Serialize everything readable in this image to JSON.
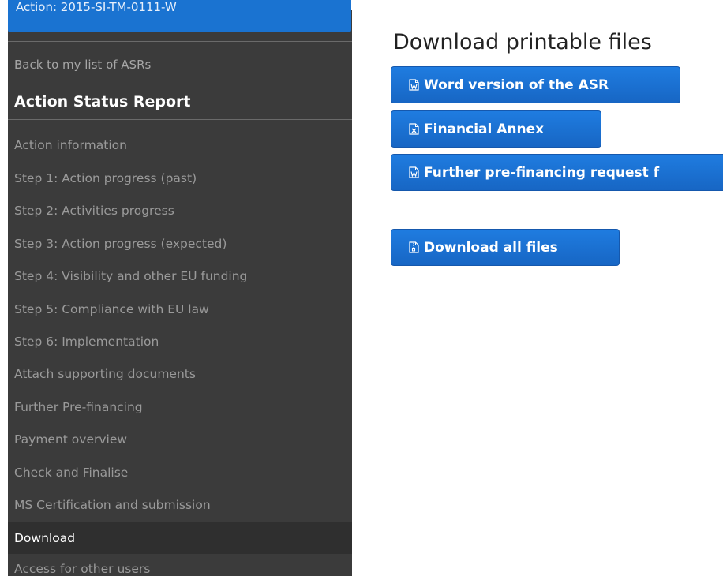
{
  "sidebar": {
    "action_label": "Action: 2015-SI-TM-0111-W",
    "back_link": "Back to my list of ASRs",
    "section_title": "Action Status Report",
    "items": [
      {
        "label": "Action information"
      },
      {
        "label": "Step 1: Action progress (past)"
      },
      {
        "label": "Step 2: Activities progress"
      },
      {
        "label": "Step 3: Action progress (expected)"
      },
      {
        "label": "Step 4: Visibility and other EU funding"
      },
      {
        "label": "Step 5: Compliance with EU law"
      },
      {
        "label": "Step 6: Implementation"
      },
      {
        "label": "Attach supporting documents"
      },
      {
        "label": "Further Pre-financing"
      },
      {
        "label": "Payment overview"
      },
      {
        "label": "Check and Finalise"
      },
      {
        "label": "MS Certification and submission"
      },
      {
        "label": "Download"
      },
      {
        "label": "Access for other users"
      }
    ],
    "active_item": "Download"
  },
  "main": {
    "title": "Download printable files",
    "buttons": {
      "word": {
        "label": "Word version of the ASR",
        "icon": "word-file-icon"
      },
      "financial": {
        "label": "Financial Annex",
        "icon": "excel-file-icon"
      },
      "prefinancing": {
        "label": "Further pre-financing request f",
        "icon": "word-file-icon"
      },
      "download_all": {
        "label": "Download all files",
        "icon": "zip-file-icon"
      }
    }
  },
  "colors": {
    "sidebar_bg": "#3b3b3b",
    "active_bg": "#2f2f2f",
    "primary_button": "#1a73d1",
    "nav_text": "#9a9a9a"
  }
}
